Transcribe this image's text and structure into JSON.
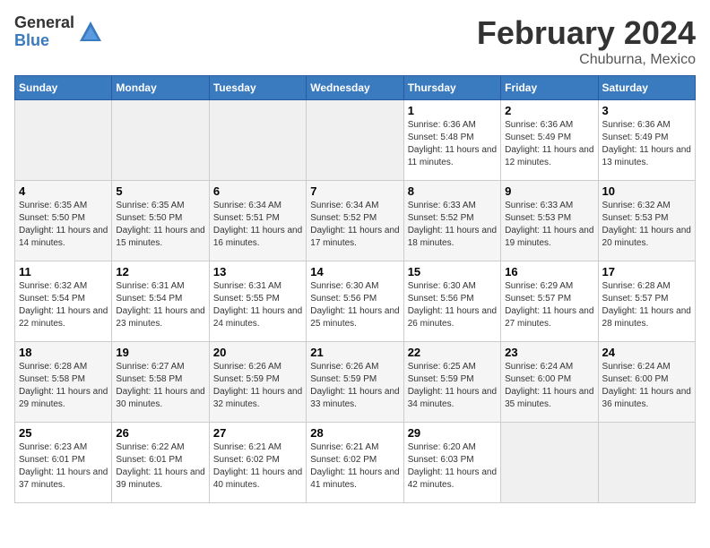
{
  "logo": {
    "general": "General",
    "blue": "Blue"
  },
  "title": "February 2024",
  "subtitle": "Chuburna, Mexico",
  "days_of_week": [
    "Sunday",
    "Monday",
    "Tuesday",
    "Wednesday",
    "Thursday",
    "Friday",
    "Saturday"
  ],
  "weeks": [
    [
      {
        "num": "",
        "info": ""
      },
      {
        "num": "",
        "info": ""
      },
      {
        "num": "",
        "info": ""
      },
      {
        "num": "",
        "info": ""
      },
      {
        "num": "1",
        "info": "Sunrise: 6:36 AM\nSunset: 5:48 PM\nDaylight: 11 hours and 11 minutes."
      },
      {
        "num": "2",
        "info": "Sunrise: 6:36 AM\nSunset: 5:49 PM\nDaylight: 11 hours and 12 minutes."
      },
      {
        "num": "3",
        "info": "Sunrise: 6:36 AM\nSunset: 5:49 PM\nDaylight: 11 hours and 13 minutes."
      }
    ],
    [
      {
        "num": "4",
        "info": "Sunrise: 6:35 AM\nSunset: 5:50 PM\nDaylight: 11 hours and 14 minutes."
      },
      {
        "num": "5",
        "info": "Sunrise: 6:35 AM\nSunset: 5:50 PM\nDaylight: 11 hours and 15 minutes."
      },
      {
        "num": "6",
        "info": "Sunrise: 6:34 AM\nSunset: 5:51 PM\nDaylight: 11 hours and 16 minutes."
      },
      {
        "num": "7",
        "info": "Sunrise: 6:34 AM\nSunset: 5:52 PM\nDaylight: 11 hours and 17 minutes."
      },
      {
        "num": "8",
        "info": "Sunrise: 6:33 AM\nSunset: 5:52 PM\nDaylight: 11 hours and 18 minutes."
      },
      {
        "num": "9",
        "info": "Sunrise: 6:33 AM\nSunset: 5:53 PM\nDaylight: 11 hours and 19 minutes."
      },
      {
        "num": "10",
        "info": "Sunrise: 6:32 AM\nSunset: 5:53 PM\nDaylight: 11 hours and 20 minutes."
      }
    ],
    [
      {
        "num": "11",
        "info": "Sunrise: 6:32 AM\nSunset: 5:54 PM\nDaylight: 11 hours and 22 minutes."
      },
      {
        "num": "12",
        "info": "Sunrise: 6:31 AM\nSunset: 5:54 PM\nDaylight: 11 hours and 23 minutes."
      },
      {
        "num": "13",
        "info": "Sunrise: 6:31 AM\nSunset: 5:55 PM\nDaylight: 11 hours and 24 minutes."
      },
      {
        "num": "14",
        "info": "Sunrise: 6:30 AM\nSunset: 5:56 PM\nDaylight: 11 hours and 25 minutes."
      },
      {
        "num": "15",
        "info": "Sunrise: 6:30 AM\nSunset: 5:56 PM\nDaylight: 11 hours and 26 minutes."
      },
      {
        "num": "16",
        "info": "Sunrise: 6:29 AM\nSunset: 5:57 PM\nDaylight: 11 hours and 27 minutes."
      },
      {
        "num": "17",
        "info": "Sunrise: 6:28 AM\nSunset: 5:57 PM\nDaylight: 11 hours and 28 minutes."
      }
    ],
    [
      {
        "num": "18",
        "info": "Sunrise: 6:28 AM\nSunset: 5:58 PM\nDaylight: 11 hours and 29 minutes."
      },
      {
        "num": "19",
        "info": "Sunrise: 6:27 AM\nSunset: 5:58 PM\nDaylight: 11 hours and 30 minutes."
      },
      {
        "num": "20",
        "info": "Sunrise: 6:26 AM\nSunset: 5:59 PM\nDaylight: 11 hours and 32 minutes."
      },
      {
        "num": "21",
        "info": "Sunrise: 6:26 AM\nSunset: 5:59 PM\nDaylight: 11 hours and 33 minutes."
      },
      {
        "num": "22",
        "info": "Sunrise: 6:25 AM\nSunset: 5:59 PM\nDaylight: 11 hours and 34 minutes."
      },
      {
        "num": "23",
        "info": "Sunrise: 6:24 AM\nSunset: 6:00 PM\nDaylight: 11 hours and 35 minutes."
      },
      {
        "num": "24",
        "info": "Sunrise: 6:24 AM\nSunset: 6:00 PM\nDaylight: 11 hours and 36 minutes."
      }
    ],
    [
      {
        "num": "25",
        "info": "Sunrise: 6:23 AM\nSunset: 6:01 PM\nDaylight: 11 hours and 37 minutes."
      },
      {
        "num": "26",
        "info": "Sunrise: 6:22 AM\nSunset: 6:01 PM\nDaylight: 11 hours and 39 minutes."
      },
      {
        "num": "27",
        "info": "Sunrise: 6:21 AM\nSunset: 6:02 PM\nDaylight: 11 hours and 40 minutes."
      },
      {
        "num": "28",
        "info": "Sunrise: 6:21 AM\nSunset: 6:02 PM\nDaylight: 11 hours and 41 minutes."
      },
      {
        "num": "29",
        "info": "Sunrise: 6:20 AM\nSunset: 6:03 PM\nDaylight: 11 hours and 42 minutes."
      },
      {
        "num": "",
        "info": ""
      },
      {
        "num": "",
        "info": ""
      }
    ]
  ]
}
